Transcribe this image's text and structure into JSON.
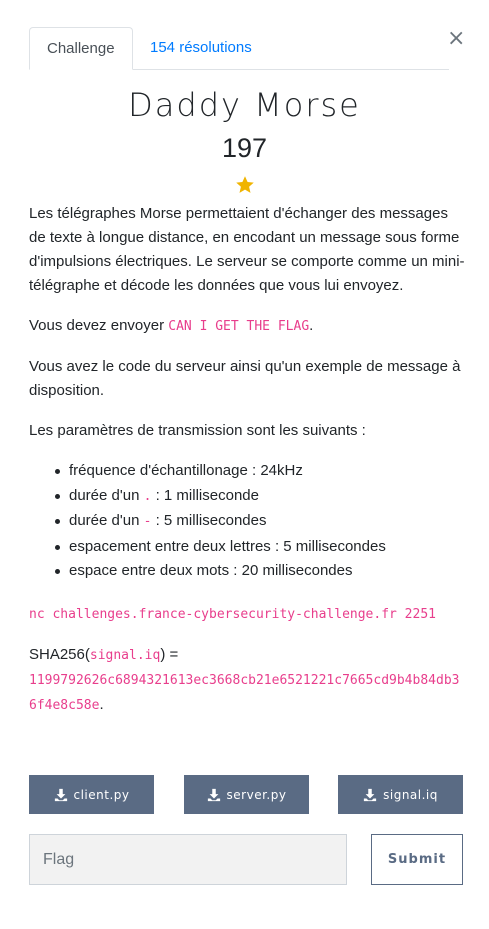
{
  "tabs": [
    {
      "label": "Challenge",
      "active": true
    },
    {
      "label": "154 résolutions",
      "active": false
    }
  ],
  "close_glyph": "×",
  "challenge": {
    "title": "Daddy Morse",
    "points": "197",
    "star_icon": "star-icon",
    "star_color": "#f0b400"
  },
  "description": {
    "p1": "Les télégraphes Morse permettaient d'échanger des messages de texte à longue distance, en encodant un message sous forme d'impulsions électriques. Le serveur se comporte comme un mini-télégraphe et décode les données que vous lui envoyez.",
    "p2_pre": "Vous devez envoyer ",
    "p2_code": "CAN I GET THE FLAG",
    "p2_post": ".",
    "p3": "Vous avez le code du serveur ainsi qu'un exemple de message à disposition.",
    "p4": "Les paramètres de transmission sont les suivants :",
    "params": [
      {
        "pre": "fréquence d'échantillonage : 24kHz",
        "code": "",
        "post": ""
      },
      {
        "pre": "durée d'un ",
        "code": ".",
        "post": " : 1 milliseconde"
      },
      {
        "pre": "durée d'un ",
        "code": "-",
        "post": " : 5 millisecondes"
      },
      {
        "pre": "espacement entre deux lettres : 5 millisecondes",
        "code": "",
        "post": ""
      },
      {
        "pre": "espace entre deux mots : 20 millisecondes",
        "code": "",
        "post": ""
      }
    ],
    "command": "nc challenges.france-cybersecurity-challenge.fr 2251",
    "sha_pre": "SHA256(",
    "sha_file": "signal.iq",
    "sha_post": ") =",
    "sha_value": "1199792626c6894321613ec3668cb21e6521221c7665cd9b4b84db36f4e8c58e",
    "sha_end": "."
  },
  "downloads": [
    {
      "label": "client.py",
      "icon": "download-icon"
    },
    {
      "label": "server.py",
      "icon": "download-icon"
    },
    {
      "label": "signal.iq",
      "icon": "download-icon"
    }
  ],
  "flag_form": {
    "placeholder": "Flag",
    "submit_label": "Submit"
  },
  "colors": {
    "accent": "#5a6b84",
    "link": "#007bff",
    "code": "#e83e8c"
  }
}
